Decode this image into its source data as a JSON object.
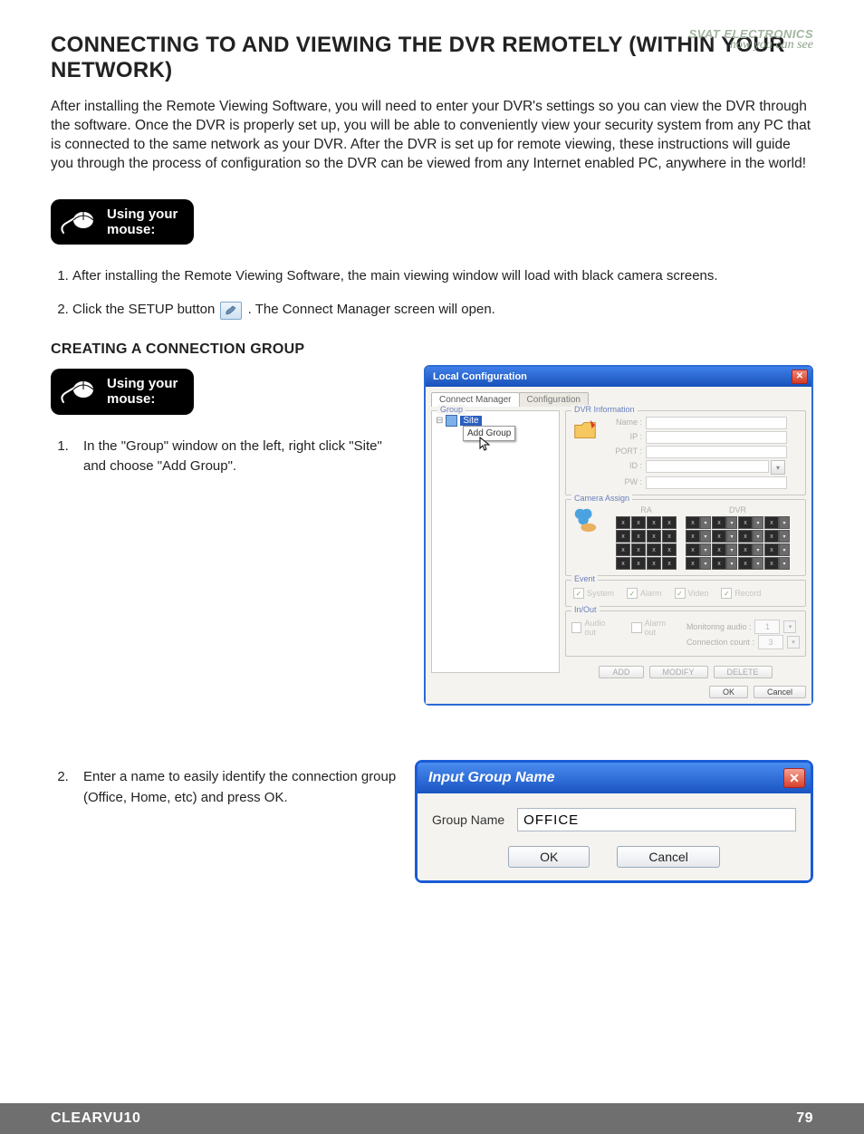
{
  "brand": {
    "line1": "SVAT ELECTRONICS",
    "line2": "now you can see"
  },
  "heading": "CONNECTING TO AND VIEWING THE DVR REMOTELY (WITHIN YOUR NETWORK)",
  "intro": "After installing the Remote Viewing Software, you will need to enter your DVR's settings so you can view the DVR through the software.  Once the DVR is properly set up, you will be able to conveniently view your security system from any PC that is connected to the same network as your DVR.  After the DVR is set up for remote viewing, these instructions will guide you through the process of configuration so the DVR can be viewed from any Internet enabled PC, anywhere in the world!",
  "mouse_label": "Using your\nmouse:",
  "steps1": {
    "s1": "After installing the Remote Viewing Software, the main viewing window will load with black camera screens.",
    "s2a": "Click the SETUP button ",
    "s2b": ".  The Connect Manager screen will open."
  },
  "subheading": "CREATING A CONNECTION GROUP",
  "steps2": {
    "s1": "In the \"Group\" window on the left, right click \"Site\" and choose \"Add Group\".",
    "s2": "Enter a name to easily identify the connection group (Office, Home, etc) and press OK."
  },
  "local_config": {
    "title": "Local Configuration",
    "tabs": {
      "t1": "Connect Manager",
      "t2": "Configuration"
    },
    "group_legend": "Group",
    "site_label": "Site",
    "ctx_item": "Add Group",
    "dvr_info": {
      "legend": "DVR Information",
      "labels": {
        "name": "Name :",
        "ip": "IP :",
        "port": "PORT :",
        "id": "ID :",
        "pw": "PW :"
      }
    },
    "camera": {
      "legend": "Camera Assign",
      "ra": "RA",
      "dvr": "DVR",
      "x": "x",
      "tri": "▾"
    },
    "event": {
      "legend": "Event",
      "items": [
        "System",
        "Alarm",
        "Video",
        "Record"
      ]
    },
    "inout": {
      "legend": "In/Out",
      "items": [
        "Audio out",
        "Alarm out"
      ],
      "mon": "Monitoring audio :",
      "mon_v": "1",
      "cc": "Connection count :",
      "cc_v": "3"
    },
    "buttons": {
      "add": "ADD",
      "modify": "MODIFY",
      "del": "DELETE",
      "ok": "OK",
      "cancel": "Cancel"
    }
  },
  "dialog": {
    "title": "Input Group Name",
    "label": "Group Name",
    "value": "OFFICE",
    "ok": "OK",
    "cancel": "Cancel"
  },
  "footer": {
    "product": "CLEARVU10",
    "page": "79"
  }
}
